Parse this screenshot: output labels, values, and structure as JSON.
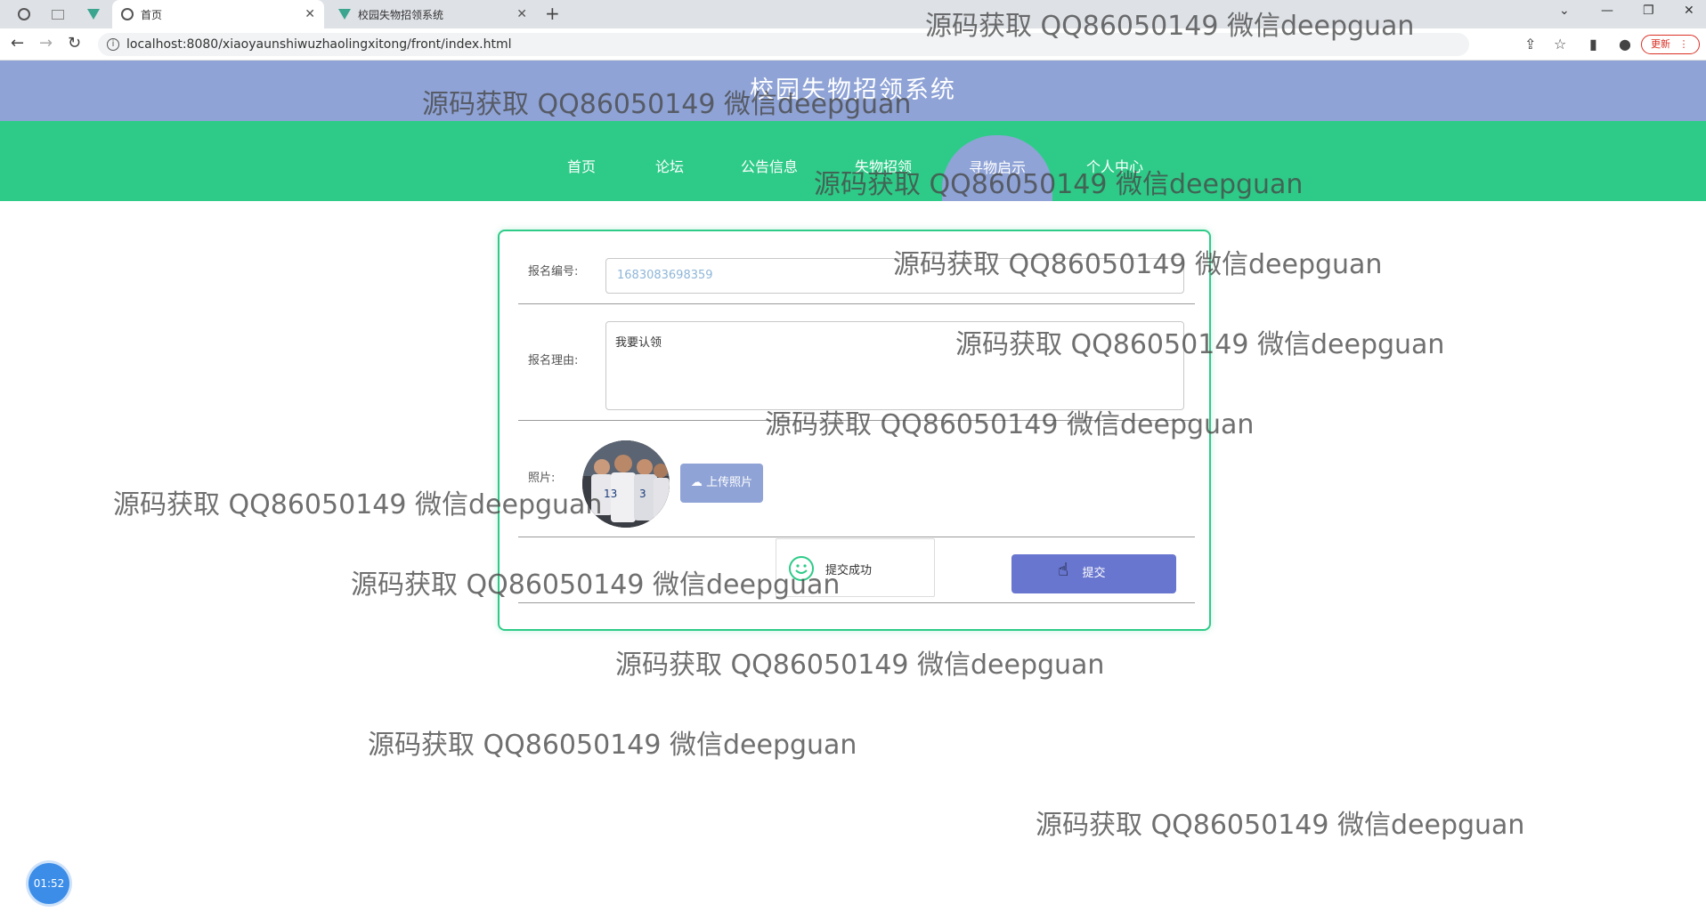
{
  "browser": {
    "tabs": [
      {
        "label": "首页"
      },
      {
        "label": "校园失物招领系统"
      }
    ],
    "url": "localhost:8080/xiaoyaunshiwuzhaolingxitong/front/index.html",
    "update_label": "更新"
  },
  "site": {
    "title": "校园失物招领系统",
    "nav": [
      {
        "label": "首页"
      },
      {
        "label": "论坛"
      },
      {
        "label": "公告信息"
      },
      {
        "label": "失物招领"
      },
      {
        "label": "寻物启示"
      },
      {
        "label": "个人中心"
      }
    ]
  },
  "form": {
    "number_label": "报名编号:",
    "number_value": "1683083698359",
    "reason_label": "报名理由:",
    "reason_value": "我要认领",
    "photo_label": "照片:",
    "upload_label": "上传照片",
    "submit_label": "提交"
  },
  "toast": {
    "text": "提交成功",
    "icon": "smile-icon"
  },
  "watermark_text": "源码获取 QQ86050149 微信deepguan",
  "timer": "01:52",
  "colors": {
    "header": "#8fa3d6",
    "nav": "#2ecb88",
    "submit": "#6876cf"
  }
}
